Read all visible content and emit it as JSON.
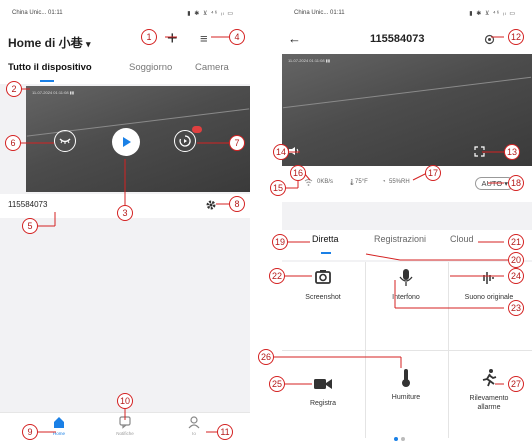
{
  "left": {
    "status": {
      "carrier": "China Unic... 01:11",
      "icons": "▮ ✱ ⊻ ⁴⁶ ᵢₗ ▭"
    },
    "header": {
      "title": "Home di 小巷",
      "caret": "▾",
      "add": "+",
      "menu": "≡"
    },
    "tabs": [
      "Tutto il dispositivo",
      "Soggiorno",
      "Camera"
    ],
    "video_stamp": "11-07-2024 01:11:08 ▮▮",
    "camera_name": "115584073",
    "nav": [
      {
        "label": "Home",
        "icon": "home-icon"
      },
      {
        "label": "Notifiche",
        "icon": "chat-icon"
      },
      {
        "label": "Io",
        "icon": "user-icon"
      }
    ]
  },
  "right": {
    "status": {
      "carrier": "China Unic... 01:11",
      "icons": "▮ ✱ ⊻ ⁴⁶ ᵢₗ ▭"
    },
    "header": {
      "back": "←",
      "title": "115584073"
    },
    "video_stamp": "11-07-2024 01:11:08 ▮▮",
    "info": {
      "bitrate": "0KB/s",
      "temp": "75°F",
      "humidity": "55%RH"
    },
    "auto": "AUTO ▾",
    "tabs": [
      "Diretta",
      "Registrazioni",
      "Cloud"
    ],
    "features": [
      {
        "label": "Screenshot",
        "icon": "camera-icon"
      },
      {
        "label": "Interfono",
        "icon": "microphone-icon"
      },
      {
        "label": "Suono originale",
        "icon": "audio-wave-icon"
      },
      {
        "label": "Registra",
        "icon": "video-camera-icon"
      },
      {
        "label": "Humiture",
        "icon": "thermometer-icon"
      },
      {
        "label": "Rilevamento allarme",
        "icon": "running-person-icon"
      }
    ]
  },
  "annotations": [
    "1",
    "2",
    "3",
    "4",
    "5",
    "6",
    "7",
    "8",
    "9",
    "10",
    "11",
    "12",
    "13",
    "14",
    "15",
    "16",
    "17",
    "18",
    "19",
    "20",
    "21",
    "22",
    "23",
    "24",
    "25",
    "26",
    "27"
  ],
  "colors": {
    "accent": "#1a80e6",
    "annotation": "#d42222",
    "play": "#1a80e6",
    "record_badge": "#e04040"
  }
}
